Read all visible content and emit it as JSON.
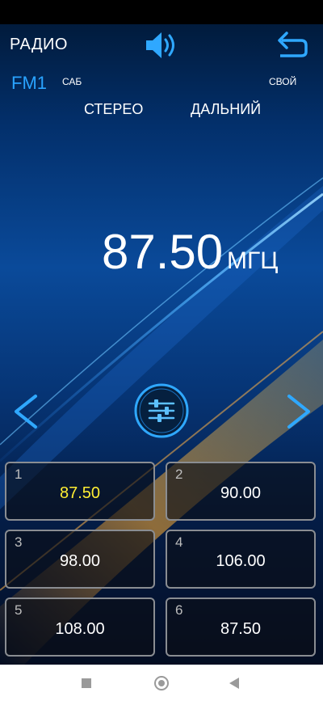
{
  "header": {
    "title": "РАДИО",
    "volume_icon": "speaker-icon",
    "back_icon": "return-arrow-icon"
  },
  "status": {
    "band": "FM1",
    "sab": "САБ",
    "own": "СВОЙ",
    "stereo": "СТЕРЕО",
    "dx": "ДАЛЬНИЙ"
  },
  "tuner": {
    "frequency": "87.50",
    "unit": "МГЦ"
  },
  "controls": {
    "prev_icon": "chevron-left-icon",
    "next_icon": "chevron-right-icon",
    "eq_icon": "sliders-icon"
  },
  "presets": [
    {
      "num": "1",
      "freq": "87.50",
      "active": true
    },
    {
      "num": "2",
      "freq": "90.00",
      "active": false
    },
    {
      "num": "3",
      "freq": "98.00",
      "active": false
    },
    {
      "num": "4",
      "freq": "106.00",
      "active": false
    },
    {
      "num": "5",
      "freq": "108.00",
      "active": false
    },
    {
      "num": "6",
      "freq": "87.50",
      "active": false
    }
  ],
  "colors": {
    "accent": "#29a3ff",
    "active_preset": "#ffee33",
    "background": "#0a4a9a"
  }
}
